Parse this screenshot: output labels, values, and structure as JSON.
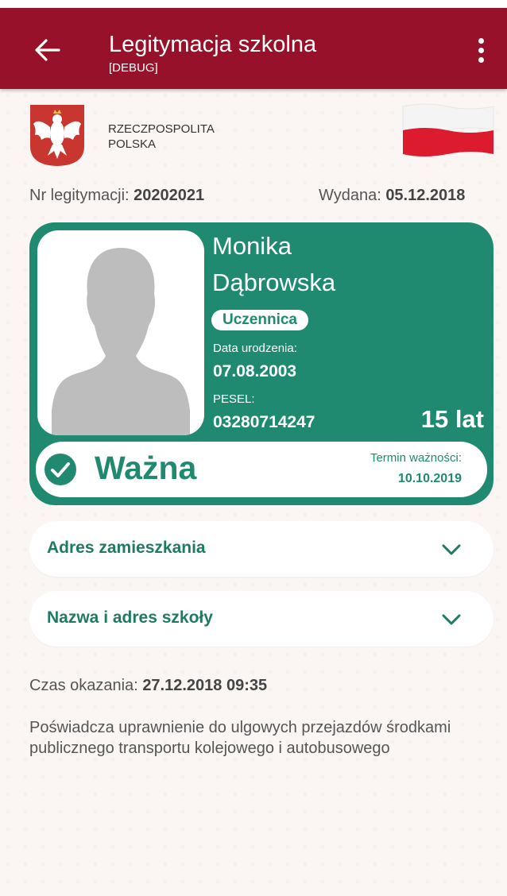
{
  "appbar": {
    "title": "Legitymacja szkolna",
    "subtitle": "[DEBUG]"
  },
  "header": {
    "country_line1": "RZECZPOSPOLITA",
    "country_line2": "POLSKA"
  },
  "info": {
    "nr_label": "Nr legitymacji:",
    "nr_value": "20202021",
    "issued_label": "Wydana:",
    "issued_value": "05.12.2018"
  },
  "card": {
    "first_name": "Monika",
    "last_name": "Dąbrowska",
    "role": "Uczennica",
    "dob_label": "Data urodzenia:",
    "dob_value": "07.08.2003",
    "pesel_label": "PESEL:",
    "pesel_value": "03280714247",
    "age": "15 lat",
    "status": "Ważna",
    "expiry_label": "Termin ważności:",
    "expiry_value": "10.10.2019"
  },
  "sections": [
    {
      "label": "Adres zamieszkania"
    },
    {
      "label": "Nazwa i adres szkoły"
    }
  ],
  "footer": {
    "shown_label": "Czas okazania:",
    "shown_value": "27.12.2018 09:35",
    "description": "Poświadcza uprawnienie do ulgowych przejazdów środkami publicznego transportu kolejowego i autobusowego"
  },
  "colors": {
    "appbar": "#98112a",
    "card": "#1f8a70",
    "background": "#fbf6f4"
  },
  "icons": [
    "back-arrow-icon",
    "more-vert-icon",
    "emblem-icon",
    "flag-icon",
    "check-circle-icon",
    "chevron-down-icon"
  ]
}
